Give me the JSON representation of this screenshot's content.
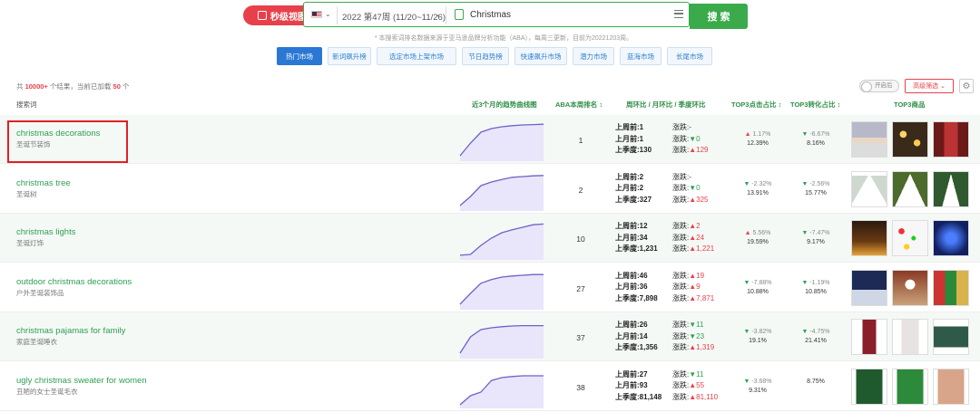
{
  "topbar": {
    "realtime_button": "秒级视图",
    "week": "2022 第47周 (11/20~11/26)",
    "keyword": "Christmas",
    "search_button": "搜 索"
  },
  "note": "* 本搜索词排名数据来源于亚马逊品牌分析功能（ABA），每周三更新，目前为20221203周。",
  "tabs": [
    "热门市场",
    "新词飙升榜",
    "选定市场上架市场",
    "节日趋势榜",
    "快速飙升市场",
    "潜力市场",
    "蓝海市场",
    "长尾市场"
  ],
  "summary": {
    "prefix": "共",
    "total": "10000+",
    "mid": "个结果，当前已加载",
    "loaded": "50",
    "suffix": "个"
  },
  "controls": {
    "toggle": "开启后",
    "filter": "高级筛选 ⌄",
    "gear": "⚙"
  },
  "headers": {
    "keyword": "搜索词",
    "trend": "近3个月的趋势曲线图",
    "rank": "ABA本周排名 ↕",
    "compare": "周环比 / 月环比 / 季度环比",
    "top3click": "TOP3点击占比 ↕",
    "top3conv": "TOP3转化占比 ↕",
    "top3products": "TOP3商品"
  },
  "labels": {
    "last_week": "上周前:",
    "last_month": "上月前:",
    "last_quarter": "上季度:",
    "change": "涨跌:"
  },
  "rows": [
    {
      "en": "christmas decorations",
      "zh": "圣诞节装饰",
      "trend": [
        0.1,
        0.45,
        0.75,
        0.85,
        0.9,
        0.93,
        0.95,
        0.96,
        0.97
      ],
      "rank": "1",
      "lw": "1",
      "lm": "1",
      "lq": "130",
      "cw": {
        "dir": "none",
        "v": "-"
      },
      "cm": {
        "dir": "down",
        "v": "0"
      },
      "cq": {
        "dir": "up",
        "v": "129"
      },
      "click": {
        "dir": "up",
        "d": "1.17%",
        "p": "12.39%"
      },
      "conv": {
        "dir": "down",
        "d": "-6.67%",
        "p": "8.16%"
      },
      "thumbs": [
        "sunset-scene",
        "gold-garland",
        "red-door-decor"
      ]
    },
    {
      "en": "christmas tree",
      "zh": "圣诞树",
      "trend": [
        0.1,
        0.35,
        0.65,
        0.75,
        0.82,
        0.88,
        0.9,
        0.92,
        0.93
      ],
      "rank": "2",
      "lw": "2",
      "lm": "2",
      "lq": "327",
      "cw": {
        "dir": "none",
        "v": "-"
      },
      "cm": {
        "dir": "down",
        "v": "0"
      },
      "cq": {
        "dir": "up",
        "v": "325"
      },
      "click": {
        "dir": "down",
        "d": "-2.32%",
        "p": "13.91%"
      },
      "conv": {
        "dir": "down",
        "d": "-2.56%",
        "p": "15.77%"
      },
      "thumbs": [
        "flocked-tree",
        "lit-tree",
        "slim-tree"
      ]
    },
    {
      "en": "christmas lights",
      "zh": "圣诞灯饰",
      "trend": [
        0.08,
        0.1,
        0.35,
        0.55,
        0.7,
        0.78,
        0.85,
        0.92,
        0.94
      ],
      "rank": "10",
      "lw": "12",
      "lm": "34",
      "lq": "1,231",
      "cw": {
        "dir": "up",
        "v": "2"
      },
      "cm": {
        "dir": "up",
        "v": "24"
      },
      "cq": {
        "dir": "up",
        "v": "1,221"
      },
      "click": {
        "dir": "up",
        "d": "5.56%",
        "p": "19.59%"
      },
      "conv": {
        "dir": "down",
        "d": "-7.47%",
        "p": "9.17%"
      },
      "thumbs": [
        "warm-lights",
        "color-bulbs",
        "blue-lights"
      ]
    },
    {
      "en": "outdoor christmas decorations",
      "zh": "户外圣诞装饰品",
      "trend": [
        0.1,
        0.4,
        0.68,
        0.78,
        0.85,
        0.88,
        0.9,
        0.92,
        0.92
      ],
      "rank": "27",
      "lw": "46",
      "lm": "36",
      "lq": "7,898",
      "cw": {
        "dir": "up",
        "v": "19"
      },
      "cm": {
        "dir": "up",
        "v": "9"
      },
      "cq": {
        "dir": "up",
        "v": "7,871"
      },
      "click": {
        "dir": "down",
        "d": "-7.88%",
        "p": "10.88%"
      },
      "conv": {
        "dir": "down",
        "d": "-1.19%",
        "p": "10.85%"
      },
      "thumbs": [
        "yard-lights",
        "snowman-set",
        "gift-boxes"
      ]
    },
    {
      "en": "christmas pajamas for family",
      "zh": "家庭圣诞睡衣",
      "trend": [
        0.1,
        0.55,
        0.75,
        0.8,
        0.83,
        0.85,
        0.86,
        0.86,
        0.86
      ],
      "rank": "37",
      "lw": "26",
      "lm": "14",
      "lq": "1,356",
      "cw": {
        "dir": "down",
        "v": "11"
      },
      "cm": {
        "dir": "down",
        "v": "23"
      },
      "cq": {
        "dir": "up",
        "v": "1,319"
      },
      "click": {
        "dir": "down",
        "d": "-3.82%",
        "p": "19.1%"
      },
      "conv": {
        "dir": "down",
        "d": "-4.75%",
        "p": "21.41%"
      },
      "thumbs": [
        "red-pajama",
        "print-pajama",
        "family-pajamas"
      ]
    },
    {
      "en": "ugly christmas sweater for women",
      "zh": "丑陋的女士圣诞毛衣",
      "trend": [
        0.05,
        0.3,
        0.4,
        0.72,
        0.8,
        0.83,
        0.85,
        0.85,
        0.85
      ],
      "rank": "38",
      "lw": "27",
      "lm": "93",
      "lq": "81,148",
      "cw": {
        "dir": "down",
        "v": "11"
      },
      "cm": {
        "dir": "up",
        "v": "55"
      },
      "cq": {
        "dir": "up",
        "v": "81,110"
      },
      "click": {
        "dir": "down",
        "d": "-3.68%",
        "p": "9.31%"
      },
      "conv": {
        "dir": "none",
        "d": "",
        "p": "8.75%"
      },
      "thumbs": [
        "tree-sweater",
        "green-sweater",
        "beige-sweater"
      ]
    }
  ]
}
